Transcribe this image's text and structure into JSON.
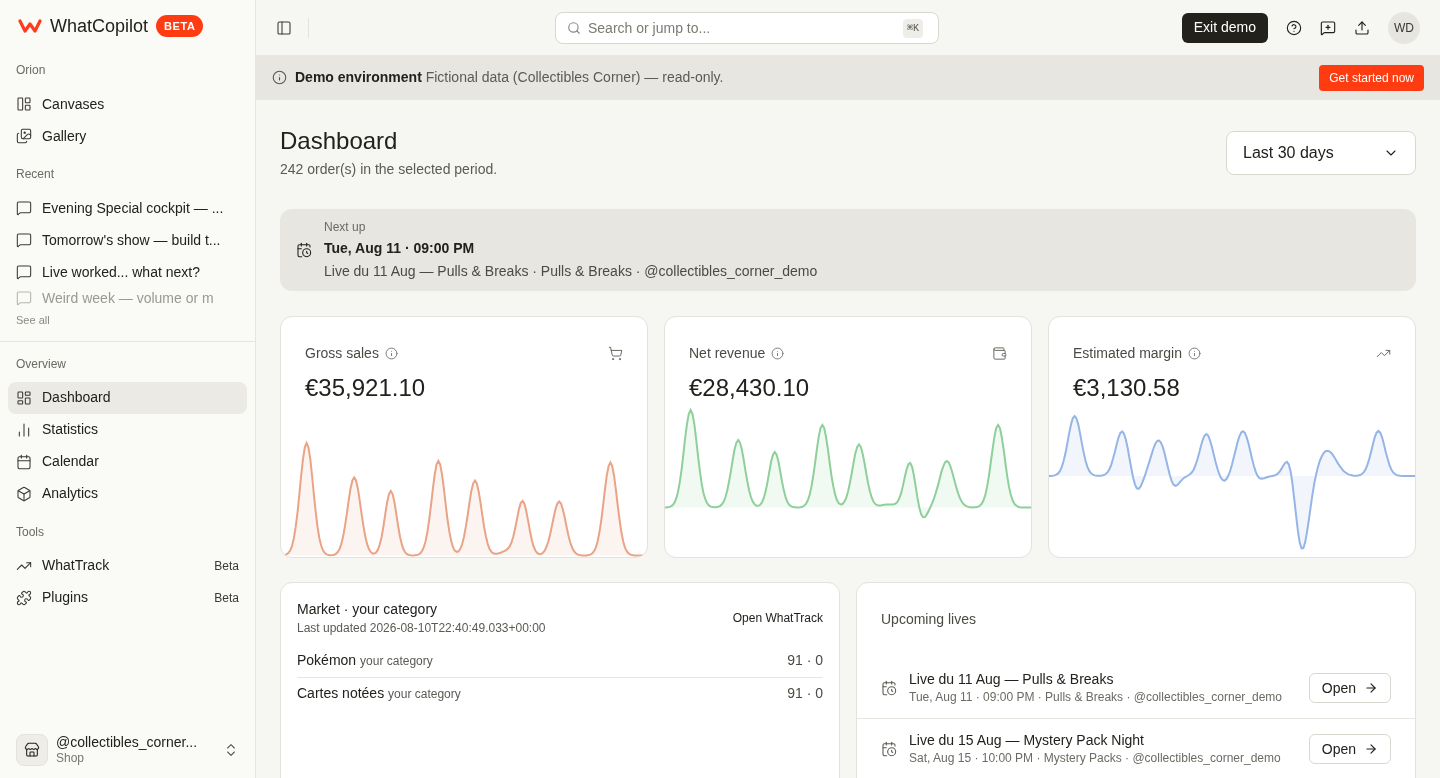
{
  "brand": {
    "name": "WhatCopilot",
    "badge": "BETA"
  },
  "sidebar": {
    "sections": [
      {
        "title": "Orion",
        "items": [
          {
            "label": "Canvases",
            "selected": false
          },
          {
            "label": "Gallery",
            "selected": false
          }
        ]
      },
      {
        "title": "Recent",
        "items": [
          {
            "label": "Evening Special cockpit — ...",
            "selected": false,
            "faded": false
          },
          {
            "label": "Tomorrow's show — build t...",
            "selected": false,
            "faded": false
          },
          {
            "label": "Live worked... what next?",
            "selected": false,
            "faded": false
          },
          {
            "label": "Weird week — volume or m",
            "selected": false,
            "faded": true
          }
        ],
        "link": "See all"
      },
      {
        "title": "Overview",
        "items": [
          {
            "label": "Dashboard",
            "selected": true
          },
          {
            "label": "Statistics",
            "selected": false
          },
          {
            "label": "Calendar",
            "selected": false
          },
          {
            "label": "Analytics",
            "selected": false
          }
        ]
      },
      {
        "title": "Tools",
        "items": [
          {
            "label": "WhatTrack",
            "selected": false,
            "badge": "Beta"
          },
          {
            "label": "Plugins",
            "selected": false,
            "badge": "Beta"
          }
        ]
      }
    ],
    "account": {
      "name": "@collectibles_corner...",
      "role": "Shop"
    }
  },
  "header": {
    "search_placeholder": "Search or jump to...",
    "shortcut": "⌘K",
    "exit_button": "Exit demo",
    "avatar": "WD"
  },
  "banner": {
    "title": "Demo environment",
    "text": "Fictional data (Collectibles Corner) — read-only.",
    "button": "Get started now"
  },
  "page": {
    "title": "Dashboard",
    "subtitle": "242 order(s) in the selected period.",
    "period": "Last 30 days"
  },
  "next_up": {
    "label": "Next up",
    "date": "Tue, Aug 11 · 09:00 PM",
    "detail": "Live du 11 Aug — Pulls & Breaks · Pulls & Breaks · @collectibles_corner_demo"
  },
  "metrics": [
    {
      "label": "Gross sales",
      "value": "€35,921.10",
      "color": "#e9a386"
    },
    {
      "label": "Net revenue",
      "value": "€28,430.10",
      "color": "#8fcf9a"
    },
    {
      "label": "Estimated margin",
      "value": "€3,130.58",
      "color": "#95b5e6"
    }
  ],
  "market": {
    "title": "Market · your category",
    "updated": "Last updated 2026-08-10T22:40:49.033+00:00",
    "link": "Open WhatTrack",
    "rows": [
      {
        "name": "Pokémon",
        "tag": "your category",
        "value": "91 · 0"
      },
      {
        "name": "Cartes notées",
        "tag": "your category",
        "value": "91 · 0"
      }
    ]
  },
  "upcoming": {
    "title": "Upcoming lives",
    "items": [
      {
        "title": "Live du 11 Aug — Pulls & Breaks",
        "detail": "Tue, Aug 11 · 09:00 PM · Pulls & Breaks · @collectibles_corner_demo",
        "button": "Open"
      },
      {
        "title": "Live du 15 Aug — Mystery Pack Night",
        "detail": "Sat, Aug 15 · 10:00 PM · Mystery Packs · @collectibles_corner_demo",
        "button": "Open"
      }
    ]
  }
}
